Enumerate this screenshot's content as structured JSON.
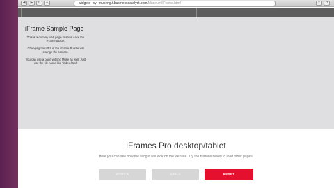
{
  "browser": {
    "nav_back": "◀",
    "nav_forward": "▶",
    "nav_reload": "↻",
    "nav_home": "⌂",
    "address_host": "widgets--by--museng.t.businesscatalyst.com",
    "address_path": "/Museum/iFrame.html"
  },
  "iframe_sample": {
    "title": "iFrame Sample Page",
    "paragraph_1": "This is a dummy web page to show case the iFrame usage.",
    "paragraph_2": "Changing the URL in the iFrame Builder will change the content.",
    "paragraph_3": "You can use a page withing Muse as well. Just use the file name like \"index.html\""
  },
  "section": {
    "heading": "iFrames Pro desktop/tablet",
    "subtext": "Here you can see how the widget will look on the website. Try the buttons below to load other pages."
  },
  "buttons": {
    "mobile_label": "MOBILE",
    "apply_label": "APPLY",
    "reset_label": "RESET"
  },
  "colors": {
    "background": "#6a2a5c",
    "accent_red": "#e5102e",
    "button_disabled": "#d6d6d6",
    "preview_gray": "#dfdfe1"
  }
}
